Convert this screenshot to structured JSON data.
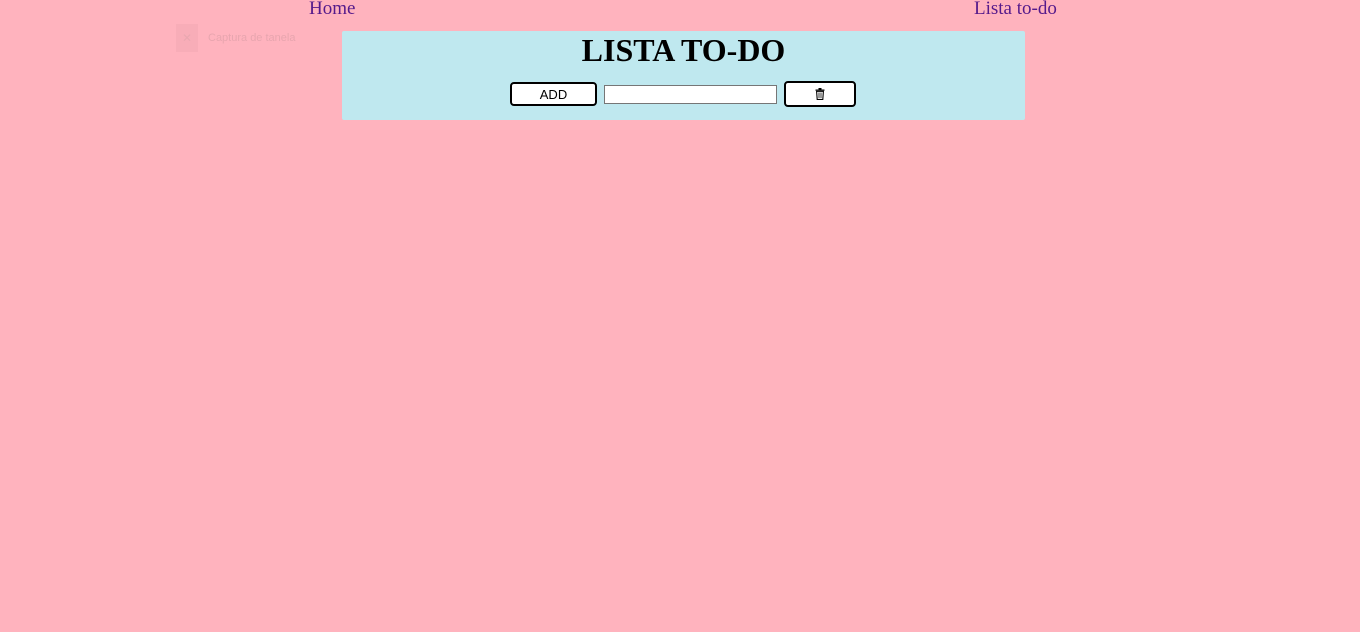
{
  "nav": {
    "home_label": "Home",
    "todo_label": "Lista to-do"
  },
  "overlay": {
    "close_glyph": "✕",
    "label": "Captura de tanela"
  },
  "panel": {
    "title": "LISTA TO-DO",
    "add_label": "ADD",
    "input_value": "",
    "input_placeholder": "",
    "delete_icon": "trash-icon"
  },
  "colors": {
    "page_background": "#ffb3be",
    "panel_background": "#bfe8ef",
    "link": "#551a8b"
  }
}
